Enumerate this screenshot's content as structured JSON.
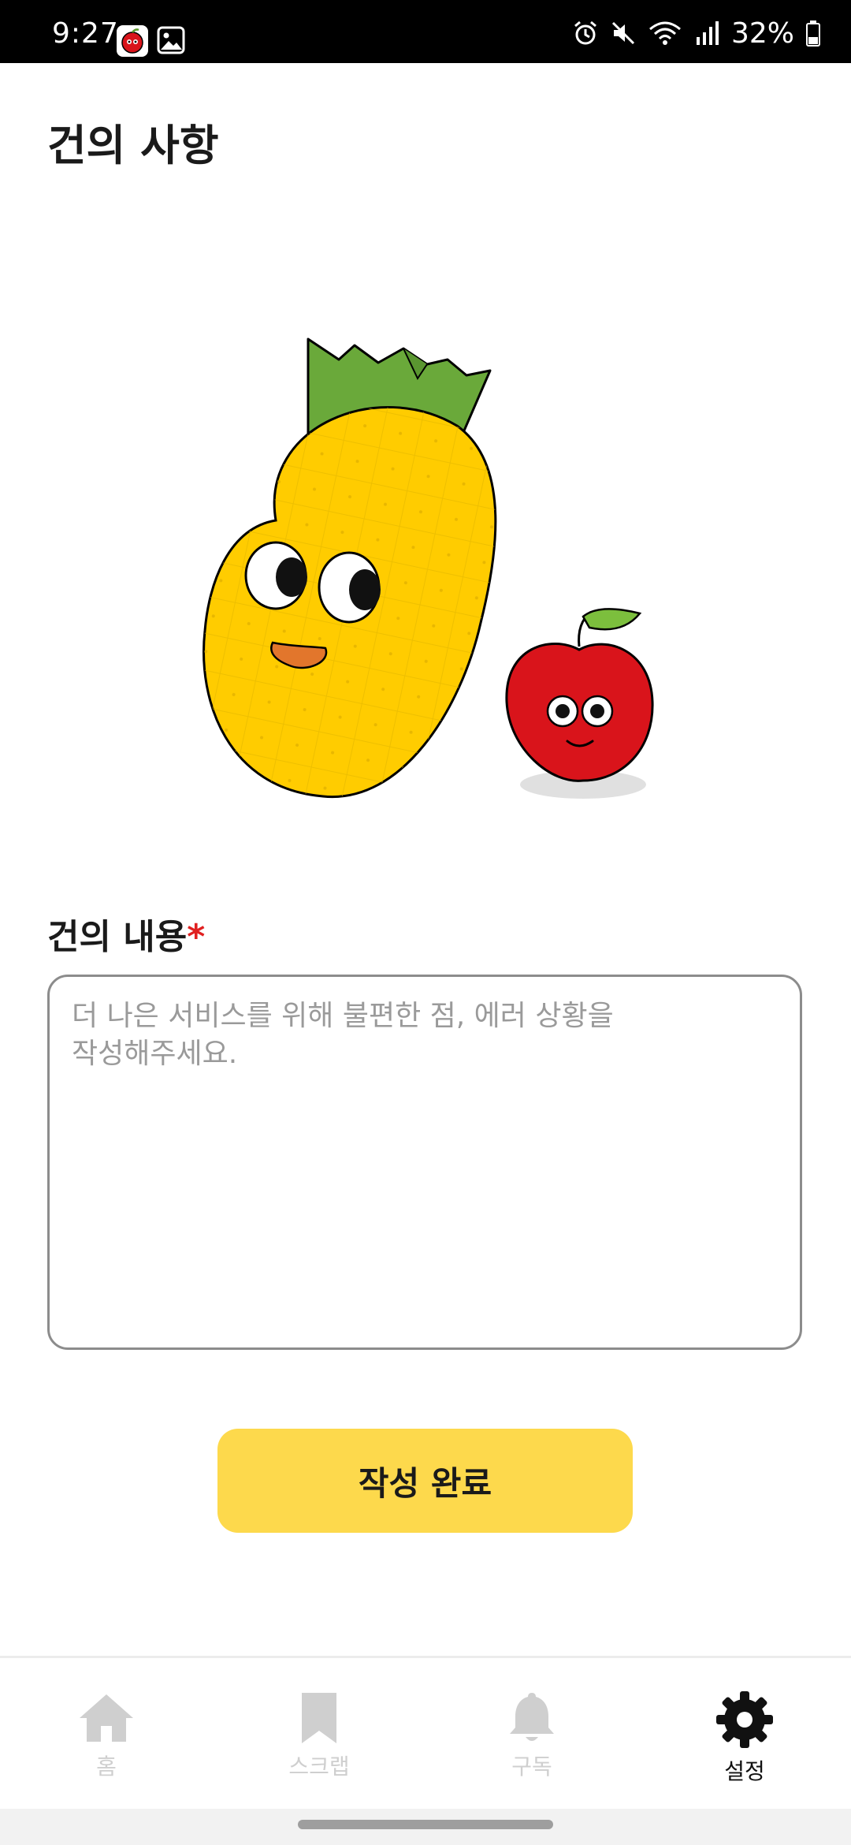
{
  "status_bar": {
    "time": "9:27",
    "battery": "32%",
    "icons": [
      "app-notification-icon",
      "gallery-icon",
      "alarm-icon",
      "mute-icon",
      "wifi-icon",
      "signal-icon",
      "battery-icon"
    ]
  },
  "page": {
    "title": "건의 사항"
  },
  "form": {
    "label": "건의 내용",
    "required_mark": "*",
    "placeholder": "더 나은 서비스를 위해 불편한 점, 에러 상황을\n작성해주세요.",
    "value": "",
    "submit_label": "작성 완료"
  },
  "bottom_nav": {
    "items": [
      {
        "label": "홈",
        "icon": "home-icon",
        "active": false
      },
      {
        "label": "스크랩",
        "icon": "bookmark-icon",
        "active": false
      },
      {
        "label": "구독",
        "icon": "bell-icon",
        "active": false
      },
      {
        "label": "설정",
        "icon": "gear-icon",
        "active": true
      }
    ]
  },
  "colors": {
    "accent": "#fdd94c",
    "required": "#e02020",
    "inactive_nav": "#cfcfcf",
    "active_nav": "#111111"
  }
}
